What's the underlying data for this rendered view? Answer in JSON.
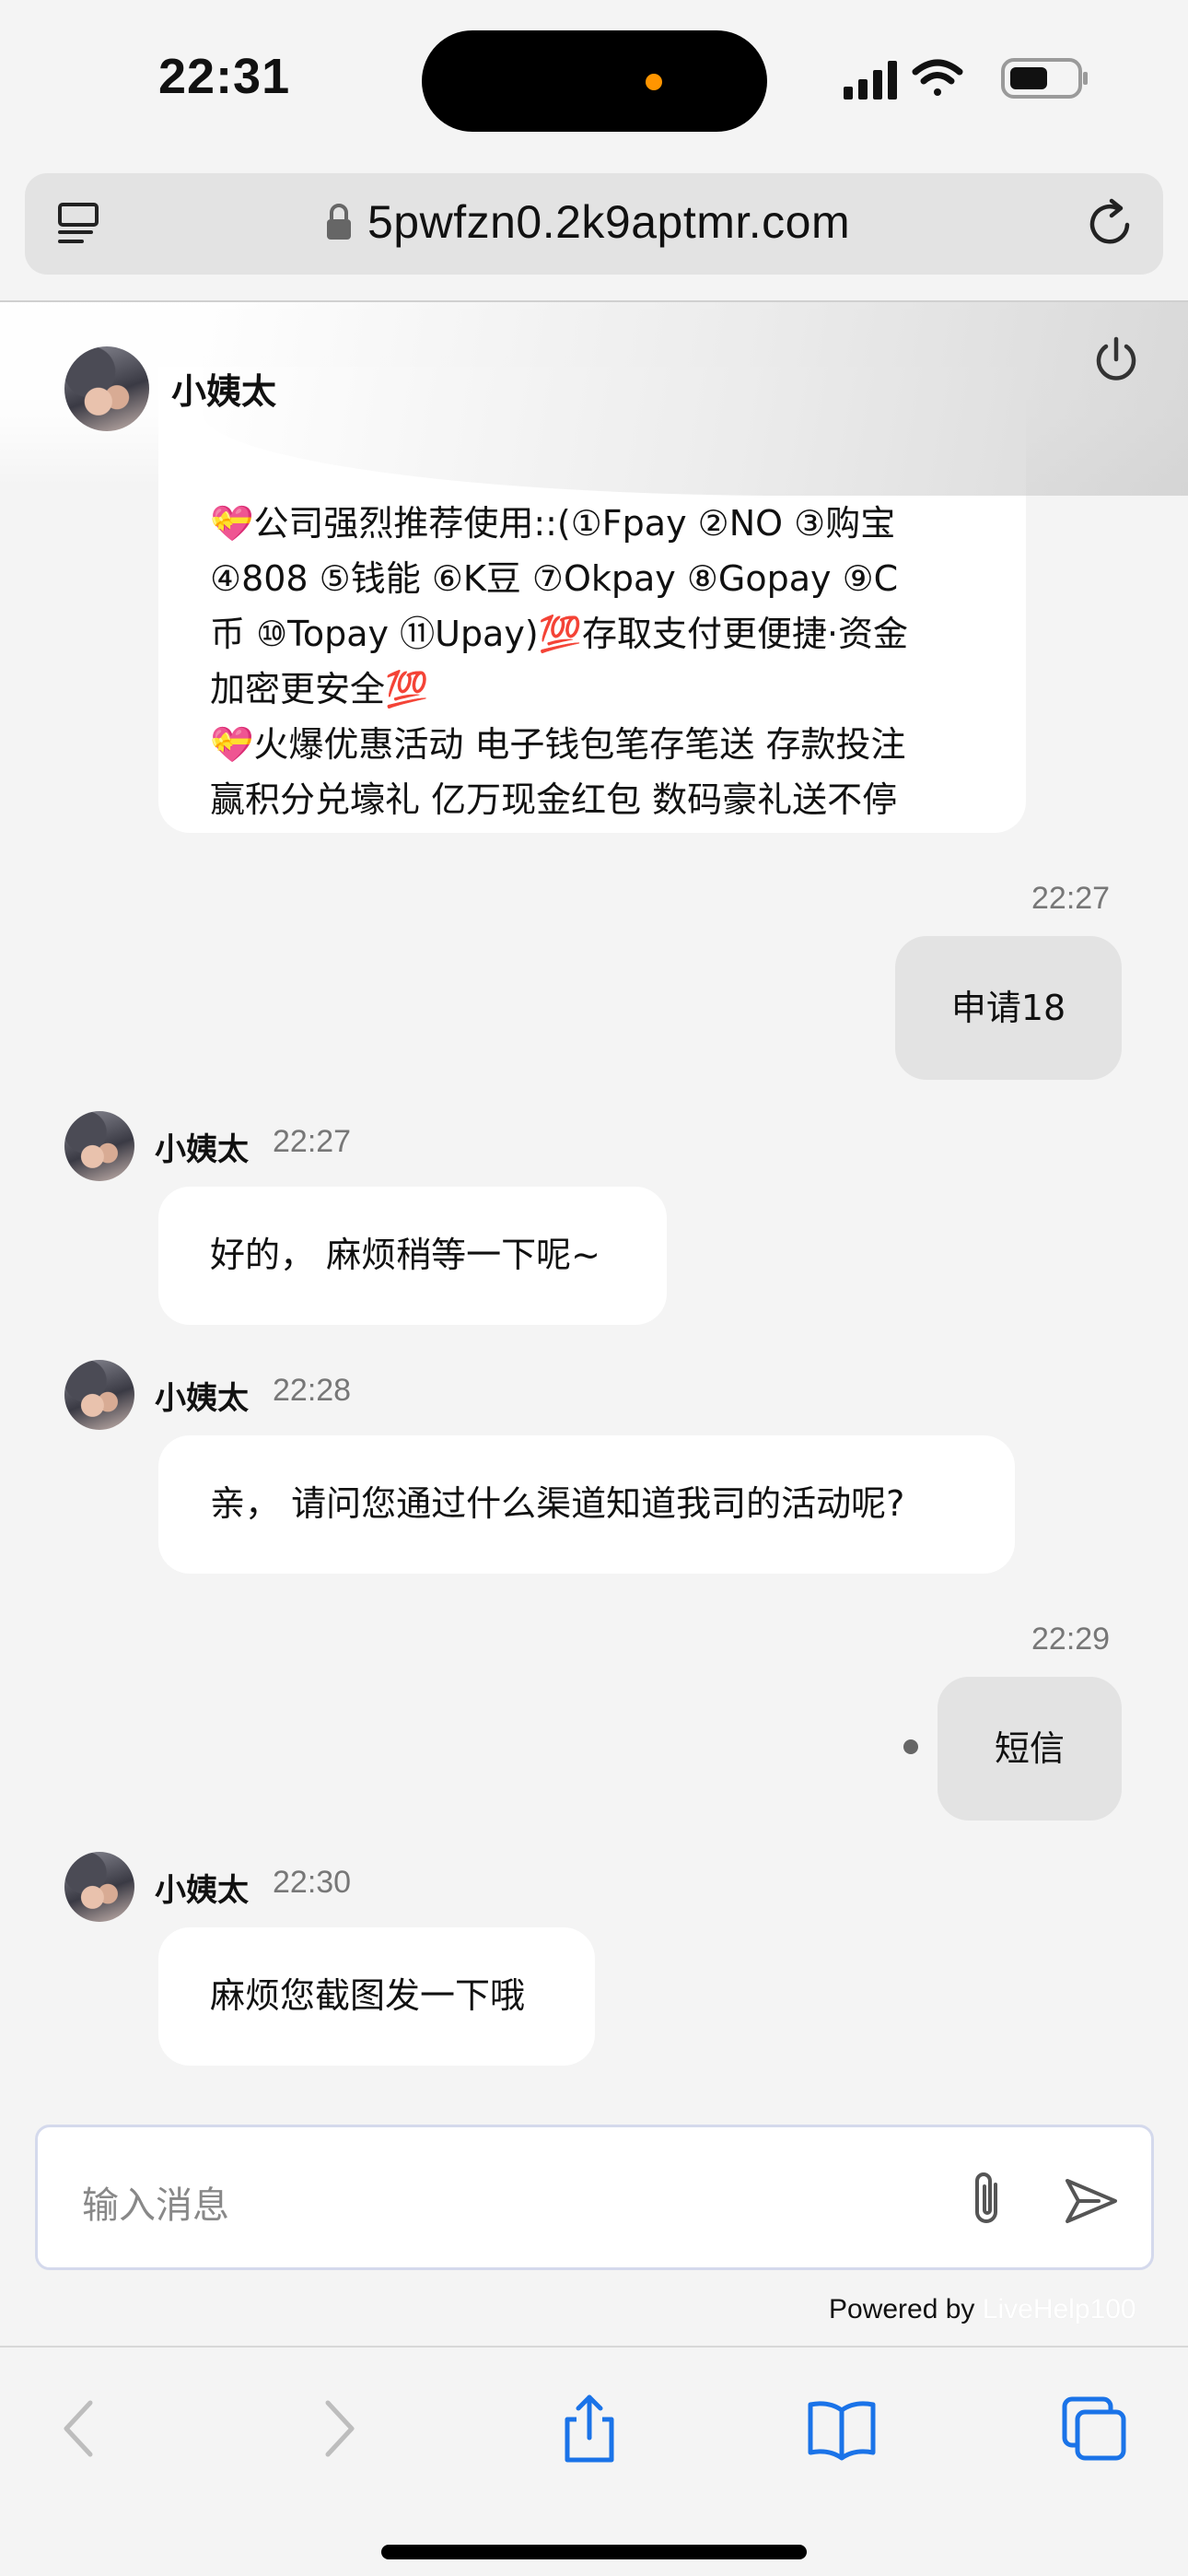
{
  "status_bar": {
    "time": "22:31"
  },
  "browser": {
    "url": "5pwfzn0.2k9aptmr.com"
  },
  "chat": {
    "agent_name": "小姨太",
    "first_message_lines": [
      "💝公司强烈推荐使用::(①Fpay ②NO ③购宝",
      "④808 ⑤钱能 ⑥K豆 ⑦Okpay ⑧Gopay ⑨C",
      "币 ⑩Topay ⑪Upay)💯存取支付更便捷·资金",
      "加密更安全💯",
      "💝火爆优惠活动 电子钱包笔存笔送 存款投注",
      "赢积分兑壕礼 亿万现金红包 数码豪礼送不停"
    ],
    "messages": [
      {
        "from": "me",
        "time": "22:27",
        "text": "申请18"
      },
      {
        "from": "agent",
        "name": "小姨太",
        "time": "22:27",
        "text": "好的， 麻烦稍等一下呢~"
      },
      {
        "from": "agent",
        "name": "小姨太",
        "time": "22:28",
        "text": "亲， 请问您通过什么渠道知道我司的活动呢?"
      },
      {
        "from": "me",
        "time": "22:29",
        "text": "短信"
      },
      {
        "from": "agent",
        "name": "小姨太",
        "time": "22:30",
        "text": "麻烦您截图发一下哦"
      }
    ],
    "input_placeholder": "输入消息",
    "powered_by": "Powered by",
    "powered_brand": "LiveHelp100"
  },
  "icons": {
    "reader": "reader-mode-icon",
    "lock": "lock-icon",
    "reload": "reload-icon",
    "power": "power-icon",
    "attach": "paperclip-icon",
    "send": "send-icon",
    "back": "back-chevron-icon",
    "forward": "forward-chevron-icon",
    "share": "share-icon",
    "bookmarks": "book-icon",
    "tabs": "tabs-icon"
  },
  "colors": {
    "accent": "#1a73e8",
    "me_bubble": "#e3e3e3",
    "agent_bubble": "#ffffff",
    "island_dot": "#ff9500"
  }
}
